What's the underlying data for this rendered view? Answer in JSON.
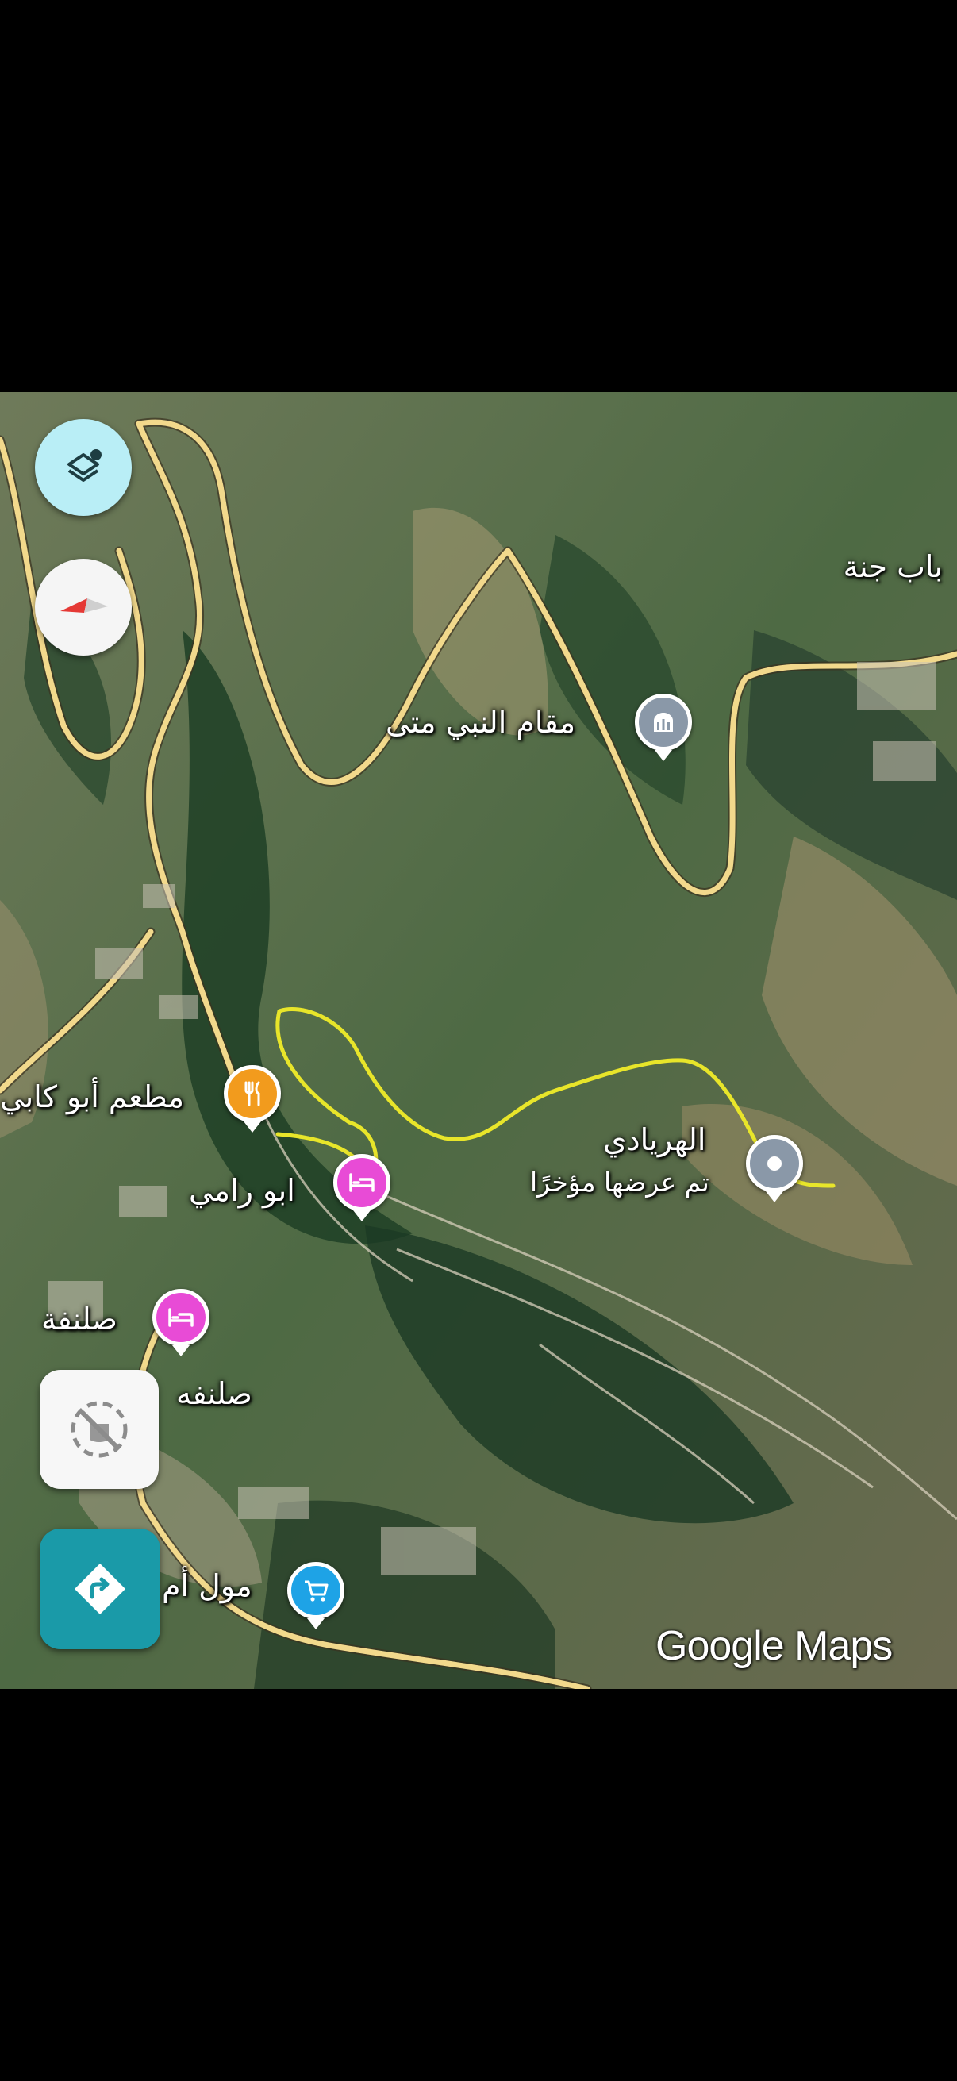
{
  "map": {
    "labels": {
      "bab_janna": "باب جنة",
      "maqam": "مقام النبي متى",
      "restaurant": "مطعم أبو كابي",
      "hotel_abu_rami": "ابو رامي",
      "hariyadi": "الهريادي",
      "hariyadi_sub": "تم عرضها مؤخرًا",
      "hotel_slunfa": "صلنفة",
      "town": "صلنفه",
      "mall": "مول أم"
    },
    "watermark": "Google Maps"
  },
  "colors": {
    "road": "#f2d98c",
    "route": "#e8e52a",
    "pin_food": "#f29b1d",
    "pin_hotel": "#e84bd6",
    "pin_shop": "#1ea3e6",
    "pin_place": "#8a98a8",
    "fab_directions": "#1a9aa8"
  },
  "icons": [
    "layers-icon",
    "compass-icon",
    "location-off-icon",
    "directions-icon",
    "restaurant-icon",
    "hotel-icon",
    "shopping-cart-icon",
    "monument-icon",
    "recent-place-icon"
  ]
}
